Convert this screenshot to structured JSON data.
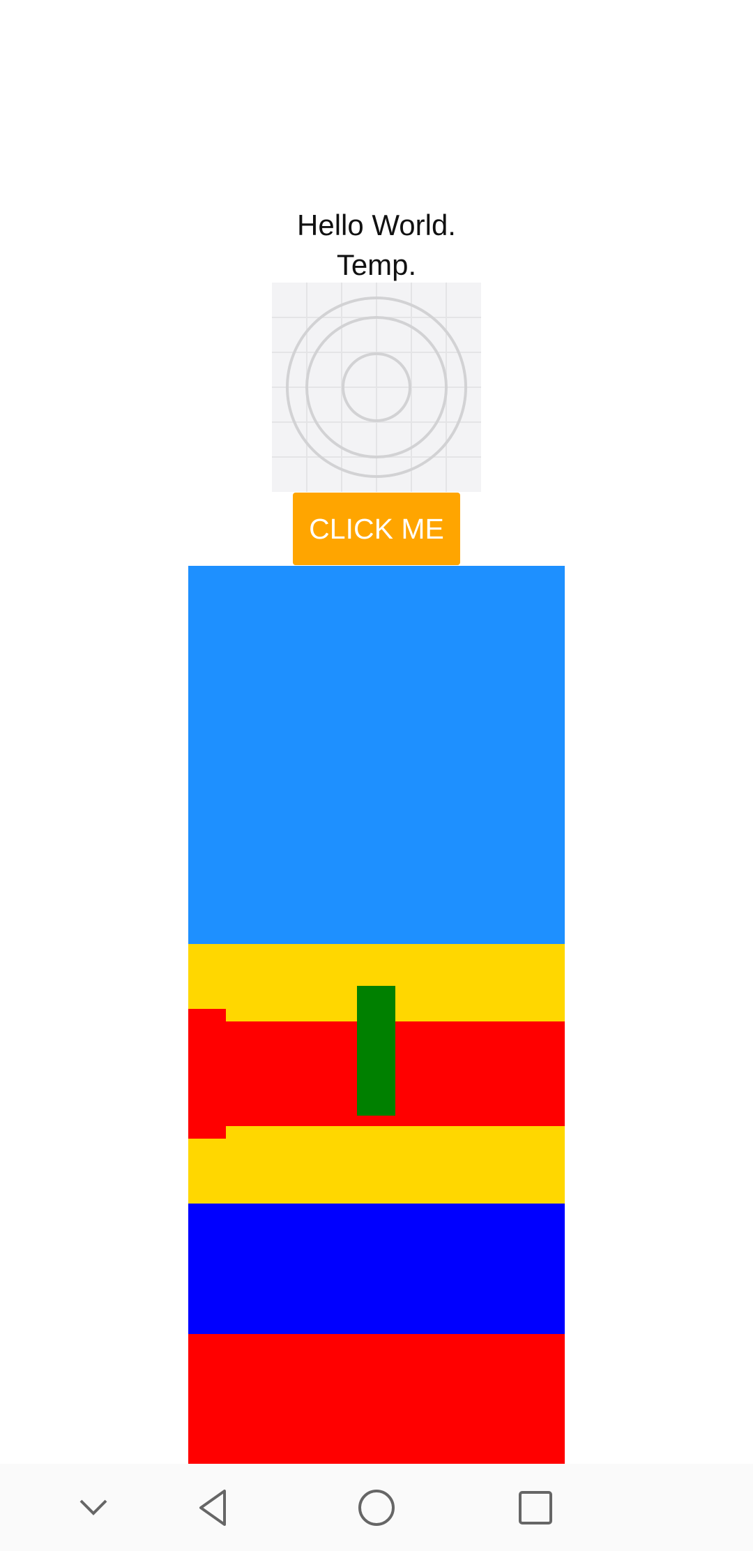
{
  "content": {
    "hello_text": "Hello World.",
    "temp_text": "Temp.",
    "image": {
      "icon": "image-placeholder-icon"
    },
    "button": {
      "label": "CLICK ME",
      "color": "#FFA500"
    }
  },
  "colors": {
    "blue_top": "#1E90FF",
    "yellow": "#FFD700",
    "red": "#FF0000",
    "green": "#008000",
    "blue_bottom": "#0000FF"
  },
  "nav_bar": {
    "items": [
      {
        "icon": "chevron-down-icon"
      },
      {
        "icon": "back-icon"
      },
      {
        "icon": "home-icon"
      },
      {
        "icon": "recents-icon"
      }
    ]
  }
}
